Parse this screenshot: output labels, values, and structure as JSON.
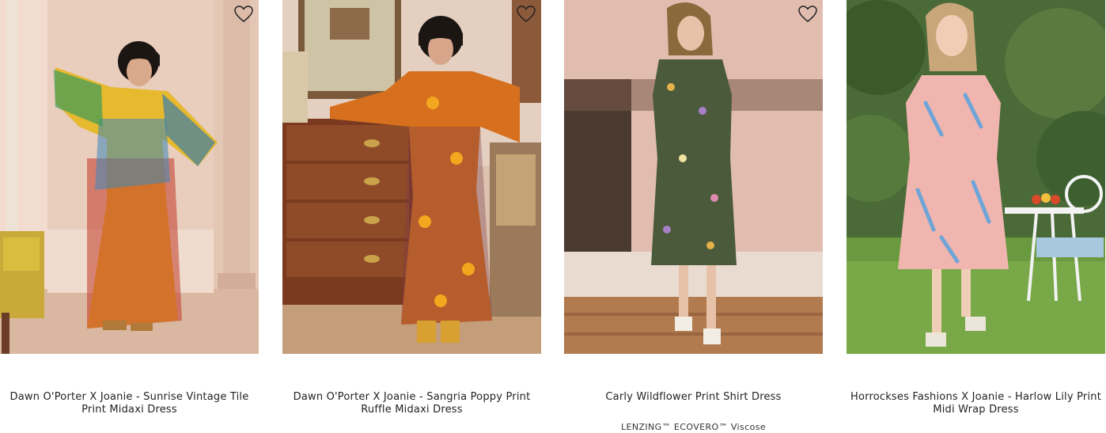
{
  "products": [
    {
      "title": "Dawn O'Porter X Joanie - Sunrise Vintage Tile Print Midaxi Dress",
      "subtitle": "",
      "wishlist_icon": "heart-outline-icon"
    },
    {
      "title": "Dawn O'Porter X Joanie - Sangria Poppy Print Ruffle Midaxi Dress",
      "subtitle": "",
      "wishlist_icon": "heart-outline-icon"
    },
    {
      "title": "Carly Wildflower Print Shirt Dress",
      "subtitle": "LENZING™ ECOVERO™ Viscose",
      "wishlist_icon": "heart-outline-icon"
    },
    {
      "title": "Horrockses Fashions X Joanie - Harlow Lily Print Midi Wrap Dress",
      "subtitle": "",
      "wishlist_icon": "heart-outline-icon"
    }
  ]
}
